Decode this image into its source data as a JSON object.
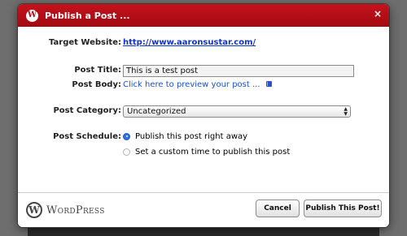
{
  "dialog": {
    "title": "Publish a Post ...",
    "wp_badge_letter": "W",
    "close_glyph": "×"
  },
  "form": {
    "target_website_label": "Target Website:",
    "target_website_url": "http://www.aaronsustar.com/",
    "post_title_label": "Post Title:",
    "post_title_value": "This is a test post",
    "post_body_label": "Post Body:",
    "post_body_link": "Click here to preview your post ...",
    "post_category_label": "Post Category:",
    "post_category_selected": "Uncategorized",
    "post_schedule_label": "Post Schedule:",
    "schedule_options": [
      {
        "label": "Publish this post right away",
        "selected": true
      },
      {
        "label": "Set a custom time to publish this post",
        "selected": false
      }
    ]
  },
  "footer": {
    "logo_letter": "W",
    "logo_text": "WordPress",
    "cancel_label": "Cancel",
    "publish_label": "Publish This Post!"
  },
  "colors": {
    "titlebar": "#b30e17",
    "link": "#1233c8",
    "radio_selected": "#2f74e6"
  },
  "icons": {
    "book_icon": "book-icon"
  }
}
